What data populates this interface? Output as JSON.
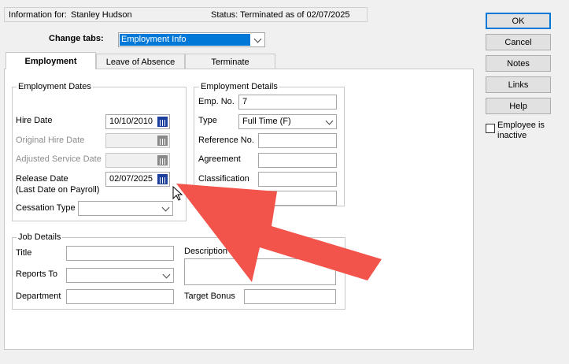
{
  "header": {
    "info_label": "Information for:",
    "employee_name": "Stanley Hudson",
    "status_text": "Status: Terminated as of 02/07/2025"
  },
  "change_tabs": {
    "label": "Change tabs:",
    "selected": "Employment Info"
  },
  "tabs": [
    {
      "label": "Employment"
    },
    {
      "label": "Leave of Absence"
    },
    {
      "label": "Terminate"
    }
  ],
  "employment_dates": {
    "title": "Employment Dates",
    "hire_date_label": "Hire Date",
    "hire_date_value": "10/10/2010",
    "original_hire_label": "Original Hire Date",
    "original_hire_value": "",
    "adjusted_service_label": "Adjusted Service Date",
    "adjusted_service_value": "",
    "release_date_label": "Release Date",
    "release_date_sublabel": "(Last Date on Payroll)",
    "release_date_value": "02/07/2025",
    "cessation_label": "Cessation Type",
    "cessation_value": ""
  },
  "employment_details": {
    "title": "Employment Details",
    "emp_no_label": "Emp. No.",
    "emp_no_value": "7",
    "type_label": "Type",
    "type_value": "Full Time (F)",
    "reference_label": "Reference No.",
    "reference_value": "",
    "agreement_label": "Agreement",
    "agreement_value": "",
    "classification_label": "Classification",
    "classification_value": "",
    "extra_value": ""
  },
  "job_details": {
    "title": "Job Details",
    "title_label": "Title",
    "title_value": "",
    "description_label": "Description",
    "description_value": "",
    "reports_to_label": "Reports To",
    "reports_to_value": "",
    "department_label": "Department",
    "department_value": "",
    "target_bonus_label": "Target Bonus",
    "target_bonus_value": ""
  },
  "buttons": {
    "ok": "OK",
    "cancel": "Cancel",
    "notes": "Notes",
    "links": "Links",
    "help": "Help"
  },
  "inactive_checkbox": {
    "line1": "Employee is",
    "line2": "inactive",
    "checked": false
  },
  "icons": {
    "calendar": "calendar-icon",
    "dropdown": "chevron-down-icon",
    "cursor": "mouse-pointer-icon",
    "arrow": "red-arrow-annotation"
  },
  "colors": {
    "window_bg": "#f0f0f0",
    "selection_blue": "#0078d7",
    "annotation_red": "#f2534a"
  }
}
